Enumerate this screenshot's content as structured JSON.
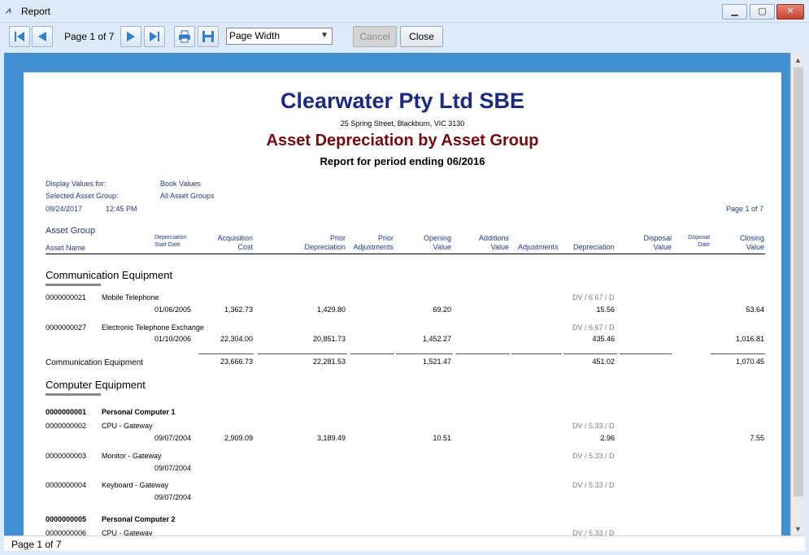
{
  "window": {
    "title": "Report"
  },
  "toolbar": {
    "page_indicator": "Page 1 of 7",
    "zoom_value": "Page Width",
    "cancel_label": "Cancel",
    "close_label": "Close"
  },
  "report": {
    "company": "Clearwater Pty Ltd SBE",
    "address": "25 Spring Street, Blackburn, VIC 3130",
    "title": "Asset Depreciation by Asset Group",
    "period": "Report for period ending 06/2016",
    "meta": {
      "display_label": "Display Values for:",
      "display_value": "Book Values",
      "group_label": "Selected Asset Group:",
      "group_value": "All Asset Groups",
      "date": "09/24/2017",
      "time": "12:45 PM",
      "page": "Page 1 of 7"
    },
    "headers": {
      "asset_group": "Asset Group",
      "asset_name": "Asset Name",
      "dep_start": [
        "Depreciation",
        "Start Date"
      ],
      "acq": [
        "Acquisition",
        "Cost"
      ],
      "prior_dep": [
        "Prior",
        "Depreciation"
      ],
      "prior_adj": [
        "Prior",
        "Adjustments"
      ],
      "opening": [
        "Opening",
        "Value"
      ],
      "additions": [
        "Additions",
        "Value"
      ],
      "adjustments": "Adjustments",
      "depreciation": "Depreciation",
      "disposal_value": [
        "Disposal",
        "Value"
      ],
      "disposal_date": [
        "Disposal",
        "Date"
      ],
      "closing": [
        "Closing",
        "Value"
      ]
    },
    "groups": [
      {
        "name": "Communication Equipment",
        "assets": [
          {
            "code": "0000000021",
            "name": "Mobile Telephone",
            "method": "DV / 6.67 / D",
            "start": "01/06/2005",
            "acq": "1,362.73",
            "prior_dep": "1,429.80",
            "opening": "69.20",
            "depreciation": "15.56",
            "closing": "53.64"
          },
          {
            "code": "0000000027",
            "name": "Electronic Telephone Exchange",
            "method": "DV / 6.67 / D",
            "start": "01/10/2006",
            "acq": "22,304.00",
            "prior_dep": "20,851.73",
            "opening": "1,452.27",
            "depreciation": "435.46",
            "closing": "1,016.81"
          }
        ],
        "total": {
          "label": "Communication Equipment",
          "acq": "23,666.73",
          "prior_dep": "22,281.53",
          "opening": "1,521.47",
          "depreciation": "451.02",
          "closing": "1,070.45"
        }
      },
      {
        "name": "Computer Equipment",
        "parents": [
          {
            "code": "0000000001",
            "name": "Personal Computer 1"
          },
          {
            "code": "0000000005",
            "name": "Personal Computer 2"
          }
        ],
        "assets": [
          {
            "code": "0000000002",
            "name": "CPU - Gateway",
            "method": "DV / 5.33 / D",
            "start": "09/07/2004",
            "acq": "2,909.09",
            "prior_dep": "3,189.49",
            "opening": "10.51",
            "depreciation": "2.96",
            "closing": "7.55"
          },
          {
            "code": "0000000003",
            "name": "Monitor - Gateway",
            "method": "DV / 5.33 / D",
            "start": "09/07/2004"
          },
          {
            "code": "0000000004",
            "name": "Keyboard - Gateway",
            "method": "DV / 5.33 / D",
            "start": "09/07/2004"
          },
          {
            "code": "0000000006",
            "name": "CPU - Gateway",
            "method": "DV / 5.33 / D"
          }
        ]
      }
    ]
  },
  "status": {
    "page": "Page 1 of 7"
  }
}
